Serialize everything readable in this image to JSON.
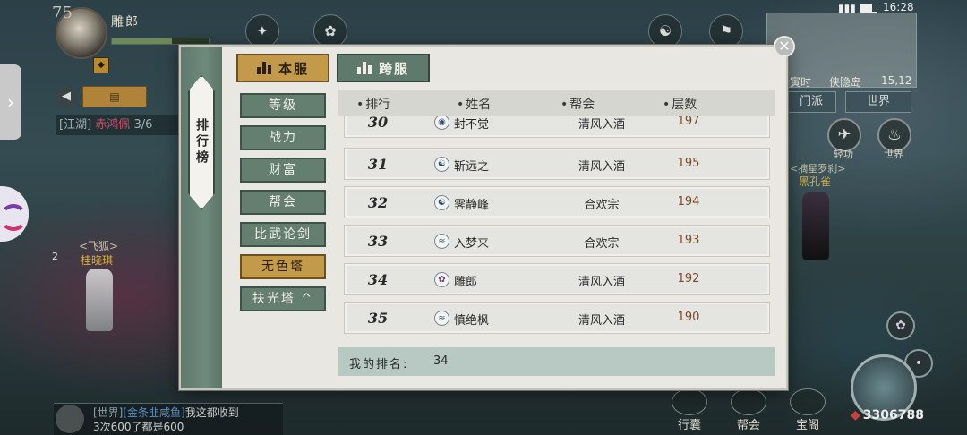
{
  "hud": {
    "player_level": "75",
    "player_name": "雕郎",
    "hp_fraction": 0.62,
    "quest_tag": "[江湖]",
    "quest_target": "赤鸿佩",
    "quest_progress": "3/6",
    "npc_tag": "<飞狐>",
    "npc_name": "桂晓琪",
    "npc_count": "2",
    "boss_tag": "<摘星罗刹>",
    "boss_name": "黑孔雀",
    "clock": "16:28",
    "map_time": "寅时",
    "map_location": "侠隐岛",
    "map_coord": "15,12",
    "channel_sect": "门派",
    "channel_world": "世界",
    "skill_qinggong": "轻功",
    "skill_world": "世界",
    "bottom_bag": "行囊",
    "bottom_guild": "帮会",
    "bottom_treasure": "宝阁",
    "gold": "3306788",
    "chat_channel": "[世界]",
    "chat_sender": "[金条韭咸鱼]",
    "chat_line1": "我这都收到",
    "chat_line2": "3次600了都是600"
  },
  "leaderboard": {
    "title": "排行榜",
    "tabs": [
      {
        "label": "本服",
        "active": true
      },
      {
        "label": "跨服",
        "active": false
      }
    ],
    "categories": [
      {
        "label": "等级",
        "active": false
      },
      {
        "label": "战力",
        "active": false
      },
      {
        "label": "财富",
        "active": false
      },
      {
        "label": "帮会",
        "active": false
      },
      {
        "label": "比武论剑",
        "active": false
      },
      {
        "label": "无色塔",
        "active": true
      },
      {
        "label": "扶光塔 ^",
        "active": false
      }
    ],
    "columns": {
      "rank": "排行",
      "name": "姓名",
      "guild": "帮会",
      "floor": "层数"
    },
    "rows": [
      {
        "rank": "30",
        "icon": "coin",
        "name": "封不觉",
        "guild": "清风入酒",
        "floor": "197"
      },
      {
        "rank": "31",
        "icon": "yinyang",
        "name": "靳远之",
        "guild": "清风入酒",
        "floor": "195"
      },
      {
        "rank": "32",
        "icon": "yinyang",
        "name": "霁静峰",
        "guild": "合欢宗",
        "floor": "194"
      },
      {
        "rank": "33",
        "icon": "wave",
        "name": "入梦来",
        "guild": "合欢宗",
        "floor": "193"
      },
      {
        "rank": "34",
        "icon": "lotus",
        "name": "雕郎",
        "guild": "清风入酒",
        "floor": "192"
      },
      {
        "rank": "35",
        "icon": "wave",
        "name": "慎绝枫",
        "guild": "清风入酒",
        "floor": "190"
      }
    ],
    "my_rank_label": "我的排名:",
    "my_rank_value": "34"
  }
}
